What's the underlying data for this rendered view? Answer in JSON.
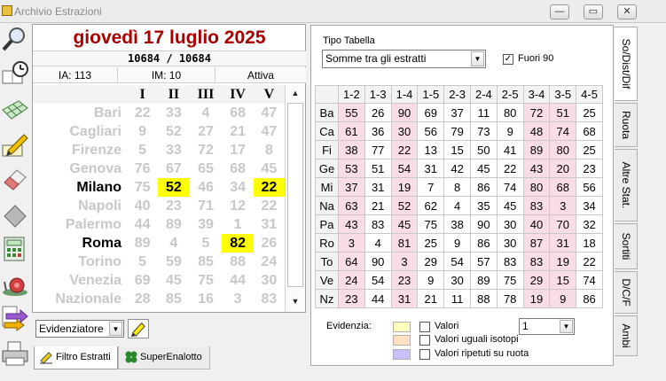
{
  "window": {
    "title": "Archivio Estrazioni",
    "min": "—",
    "max": "▭",
    "close": "✕"
  },
  "toolbar": {
    "icons": [
      "magnifier-icon",
      "clock-book-icon",
      "grid-sheet-icon",
      "pencil-edit-icon",
      "eraser-icon",
      "diamond-icon",
      "calculator-icon",
      "snail-icon",
      "arrows-icon",
      "printer-icon"
    ]
  },
  "left": {
    "date": "giovedì 17 luglio 2025",
    "concorso": "10684 / 10684",
    "ia": "IA: 113",
    "im": "IM: 10",
    "status": "Attiva",
    "columns": [
      "I",
      "II",
      "III",
      "IV",
      "V"
    ],
    "rows": [
      {
        "city": "Bari",
        "nums": [
          "22",
          "33",
          "4",
          "68",
          "47"
        ]
      },
      {
        "city": "Cagliari",
        "nums": [
          "9",
          "52",
          "27",
          "21",
          "47"
        ]
      },
      {
        "city": "Firenze",
        "nums": [
          "5",
          "33",
          "72",
          "17",
          "8"
        ]
      },
      {
        "city": "Genova",
        "nums": [
          "76",
          "67",
          "65",
          "68",
          "45"
        ]
      },
      {
        "city": "Milano",
        "nums": [
          "75",
          "52",
          "46",
          "34",
          "22"
        ]
      },
      {
        "city": "Napoli",
        "nums": [
          "40",
          "23",
          "71",
          "12",
          "22"
        ]
      },
      {
        "city": "Palermo",
        "nums": [
          "44",
          "89",
          "39",
          "1",
          "31"
        ]
      },
      {
        "city": "Roma",
        "nums": [
          "89",
          "4",
          "5",
          "82",
          "26"
        ]
      },
      {
        "city": "Torino",
        "nums": [
          "5",
          "59",
          "85",
          "88",
          "24"
        ]
      },
      {
        "city": "Venezia",
        "nums": [
          "69",
          "45",
          "75",
          "44",
          "30"
        ]
      },
      {
        "city": "Nazionale",
        "nums": [
          "28",
          "85",
          "16",
          "3",
          "83"
        ]
      }
    ],
    "evidenziatore": "Evidenziatore",
    "tabs": [
      "Filtro Estratti",
      "SuperEnalotto"
    ]
  },
  "right": {
    "tipo_label": "Tipo Tabella",
    "tipo_value": "Somme tra gli estratti",
    "fuori90": "Fuori 90",
    "fuori90_checked": "✓",
    "pairs": [
      "1-2",
      "1-3",
      "1-4",
      "1-5",
      "2-3",
      "2-4",
      "2-5",
      "3-4",
      "3-5",
      "4-5"
    ],
    "rows": [
      {
        "r": "Ba",
        "v": [
          "55",
          "26",
          "90",
          "69",
          "37",
          "11",
          "80",
          "72",
          "51",
          "25"
        ]
      },
      {
        "r": "Ca",
        "v": [
          "61",
          "36",
          "30",
          "56",
          "79",
          "73",
          "9",
          "48",
          "74",
          "68"
        ]
      },
      {
        "r": "Fi",
        "v": [
          "38",
          "77",
          "22",
          "13",
          "15",
          "50",
          "41",
          "89",
          "80",
          "25"
        ]
      },
      {
        "r": "Ge",
        "v": [
          "53",
          "51",
          "54",
          "31",
          "42",
          "45",
          "22",
          "43",
          "20",
          "23"
        ]
      },
      {
        "r": "Mi",
        "v": [
          "37",
          "31",
          "19",
          "7",
          "8",
          "86",
          "74",
          "80",
          "68",
          "56"
        ]
      },
      {
        "r": "Na",
        "v": [
          "63",
          "21",
          "52",
          "62",
          "4",
          "35",
          "45",
          "83",
          "3",
          "34"
        ]
      },
      {
        "r": "Pa",
        "v": [
          "43",
          "83",
          "45",
          "75",
          "38",
          "90",
          "30",
          "40",
          "70",
          "32"
        ]
      },
      {
        "r": "Ro",
        "v": [
          "3",
          "4",
          "81",
          "25",
          "9",
          "86",
          "30",
          "87",
          "31",
          "18"
        ]
      },
      {
        "r": "To",
        "v": [
          "64",
          "90",
          "3",
          "29",
          "54",
          "57",
          "83",
          "83",
          "19",
          "22"
        ]
      },
      {
        "r": "Ve",
        "v": [
          "24",
          "54",
          "23",
          "9",
          "30",
          "89",
          "75",
          "29",
          "15",
          "74"
        ]
      },
      {
        "r": "Nz",
        "v": [
          "23",
          "44",
          "31",
          "21",
          "11",
          "88",
          "78",
          "19",
          "9",
          "86"
        ]
      }
    ],
    "evidenzia_label": "Evidenzia:",
    "opt_valori": "Valori",
    "opt_isotopi": "Valori uguali isotopi",
    "opt_ripetuti": "Valori ripetuti su ruota",
    "valori_num": "1",
    "swatch_colors": [
      "#ffffc0",
      "#ffe0c0",
      "#c8c0ff"
    ],
    "pink_color": "#f9dde4",
    "highlight_color": "#ffff00",
    "date_color": "#a80000"
  },
  "vtabs": [
    "So/Dist/Dif",
    "Ruota",
    "Altre Stat.",
    "Sortiti",
    "D/C/F",
    "Ambi"
  ]
}
